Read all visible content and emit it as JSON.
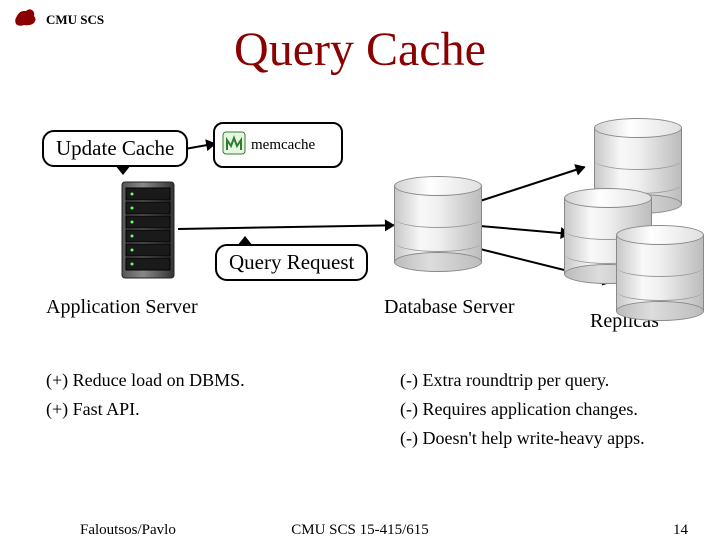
{
  "header": {
    "org": "CMU SCS"
  },
  "title": "Query Cache",
  "bubbles": {
    "update": "Update Cache",
    "query": "Query Request"
  },
  "components": {
    "memcache": "memcache",
    "app_server": "Application Server",
    "db_server": "Database Server",
    "replicas": "Replicas"
  },
  "pros": [
    "(+)  Reduce load on DBMS.",
    "(+)  Fast API."
  ],
  "cons": [
    "(-)  Extra roundtrip per query.",
    "(-)  Requires application changes.",
    "(-) Doesn't help write-heavy apps."
  ],
  "footer": {
    "left": "Faloutsos/Pavlo",
    "center": "CMU SCS 15-415/615",
    "right": "14"
  }
}
